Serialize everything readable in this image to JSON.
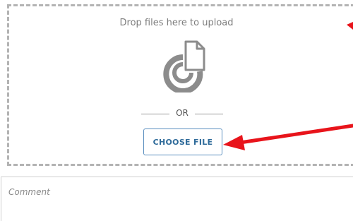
{
  "upload": {
    "drop_text": "Drop files here to upload",
    "icon": "file-upload-icon",
    "separator_text": "OR",
    "choose_button_label": "CHOOSE FILE"
  },
  "comment": {
    "placeholder": "Comment"
  },
  "annotation": {
    "color": "#e8141b",
    "icon": "red-arrow"
  },
  "colors": {
    "button_border": "#5b8fbf",
    "button_text": "#2f6b9a",
    "dashed_border": "#b3b3b3"
  }
}
